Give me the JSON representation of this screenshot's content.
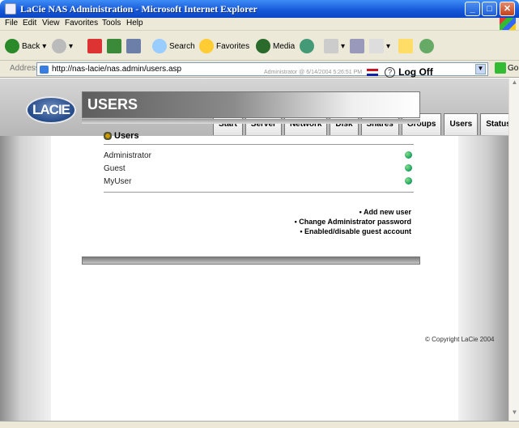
{
  "window": {
    "title": "LaCie NAS Administration - Microsoft Internet Explorer",
    "min": "_",
    "max": "□",
    "close": "✕"
  },
  "menu": [
    "File",
    "Edit",
    "View",
    "Favorites",
    "Tools",
    "Help"
  ],
  "toolbar": {
    "back": "Back",
    "search": "Search",
    "favorites": "Favorites",
    "media": "Media"
  },
  "address": {
    "label": "Address",
    "url": "http://nas-lacie/nas.admin/users.asp",
    "go": "Go"
  },
  "logo": "LACIE",
  "tabs": [
    "Start",
    "Server",
    "Network",
    "Disk",
    "Shares",
    "Groups",
    "Users",
    "Status"
  ],
  "session": {
    "info": "Administrator @ 6/14/2004 5:26:51 PM",
    "help": "?",
    "logoff": "Log Off"
  },
  "page": {
    "title": "USERS",
    "section": "Users"
  },
  "users": [
    "Administrator",
    "Guest",
    "MyUser"
  ],
  "actions": [
    "• Add new user",
    "• Change Administrator password",
    "• Enabled/disable guest account"
  ],
  "footer": {
    "copyright": "© Copyright LaCie 2004"
  },
  "colors": {
    "titlebar": "#1556d8",
    "header": "#c4c4c4",
    "status_ok": "#2a6"
  }
}
